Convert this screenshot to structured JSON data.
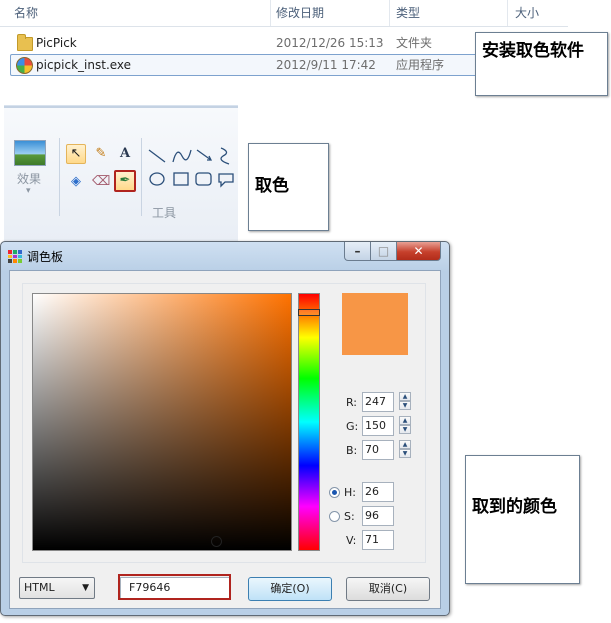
{
  "explorer": {
    "columns": [
      "名称",
      "修改日期",
      "类型",
      "大小"
    ],
    "files": [
      {
        "name": "PicPick",
        "date": "2012/12/26 15:13",
        "type": "文件夹",
        "icon": "folder-icon"
      },
      {
        "name": "picpick_inst.exe",
        "date": "2012/9/11 17:42",
        "type": "应用程序",
        "icon": "picpick-exe-icon"
      }
    ]
  },
  "callouts": {
    "install": "安装取色软件",
    "pick": "取色",
    "result": "取到的颜色"
  },
  "ribbon": {
    "effects_label": "效果",
    "tools_label": "工具",
    "text_tool_glyph": "A"
  },
  "dialog": {
    "title": "调色板",
    "window_buttons": [
      "–",
      "□",
      "✕"
    ],
    "color_hex": "#f79646",
    "labels": {
      "r": "R:",
      "g": "G:",
      "b": "B:",
      "h": "H:",
      "s": "S:",
      "v": "V:"
    },
    "values": {
      "r": "247",
      "g": "150",
      "b": "70",
      "h": "26",
      "s": "96",
      "v": "71"
    },
    "selected_mode": "H",
    "format": "HTML",
    "hex": "F79646",
    "ok_label": "确定(O)",
    "cancel_label": "取消(C)"
  },
  "colors": {
    "accent": "#f79646",
    "highlight_border": "#b0241e",
    "selection_border": "#7da2ce"
  }
}
